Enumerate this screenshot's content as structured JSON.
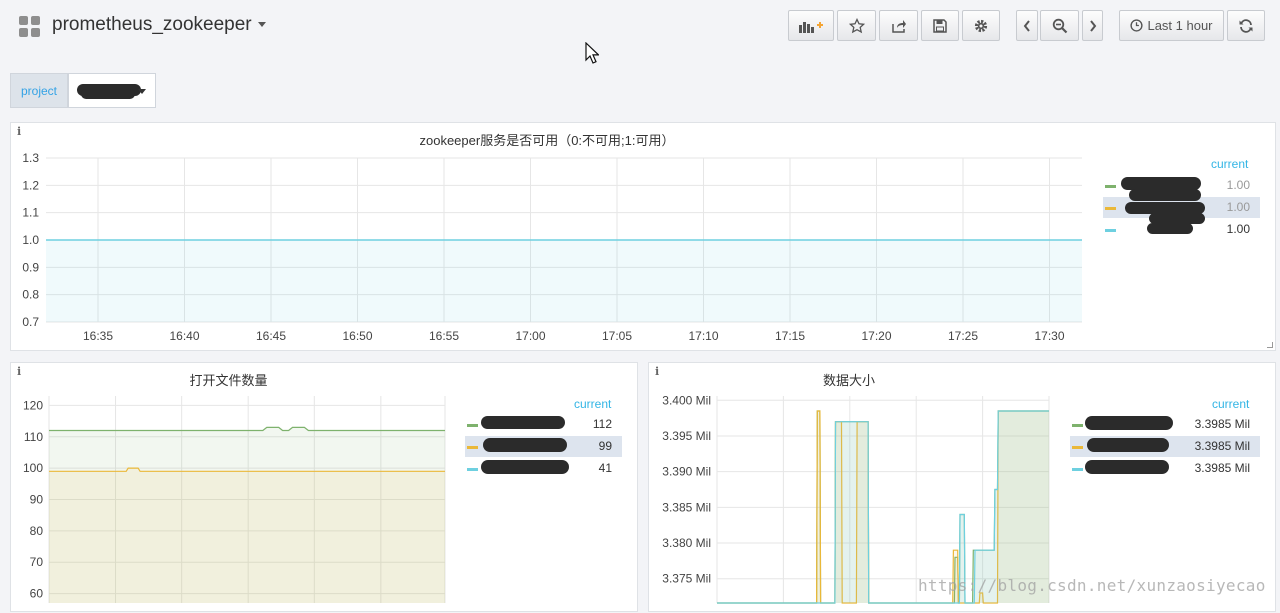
{
  "dashboard": {
    "title": "prometheus_zookeeper"
  },
  "toolbar": {
    "time_range_label": "Last 1 hour"
  },
  "variables": [
    {
      "label": "project"
    }
  ],
  "colors": {
    "green": "#7eb26d",
    "yellow": "#eab839",
    "blue": "#6ed0e0",
    "accent": "#33b5e5"
  },
  "panels": [
    {
      "title": "zookeeper服务是否可用（0:不可用;1:可用）",
      "legend_header": "current",
      "legend": [
        {
          "value": "1.00"
        },
        {
          "value": "1.00"
        },
        {
          "value": "1.00"
        }
      ]
    },
    {
      "title": "打开文件数量",
      "legend_header": "current",
      "legend": [
        {
          "value": "112"
        },
        {
          "value": "99"
        },
        {
          "value": "41"
        }
      ]
    },
    {
      "title": "数据大小",
      "legend_header": "current",
      "legend": [
        {
          "value": "3.3985 Mil"
        },
        {
          "value": "3.3985 Mil"
        },
        {
          "value": "3.3985 Mil"
        }
      ]
    }
  ],
  "chart_data": [
    {
      "type": "line",
      "title": "zookeeper服务是否可用（0:不可用;1:可用）",
      "x": [
        "16:35",
        "16:40",
        "16:45",
        "16:50",
        "16:55",
        "17:00",
        "17:05",
        "17:10",
        "17:15",
        "17:20",
        "17:25",
        "17:30"
      ],
      "y_ticks": [
        "0.7",
        "0.8",
        "0.9",
        "1.0",
        "1.1",
        "1.2",
        "1.3"
      ],
      "ylim": [
        0.7,
        1.3
      ],
      "series": [
        {
          "value": 1.0
        }
      ],
      "grid": true,
      "legend_position": "right"
    },
    {
      "type": "area",
      "title": "打开文件数量",
      "y_ticks": [
        "60",
        "70",
        "80",
        "90",
        "100",
        "110",
        "120"
      ],
      "ylim": [
        57,
        123
      ],
      "series": [
        {
          "color": "green",
          "points": [
            [
              0,
              112
            ],
            [
              0.54,
              112
            ],
            [
              0.55,
              113
            ],
            [
              0.58,
              113
            ],
            [
              0.59,
              112
            ],
            [
              0.605,
              112
            ],
            [
              0.615,
              113
            ],
            [
              0.645,
              113
            ],
            [
              0.655,
              112
            ],
            [
              1,
              112
            ]
          ]
        },
        {
          "color": "yellow",
          "points": [
            [
              0,
              99
            ],
            [
              0.195,
              99
            ],
            [
              0.2,
              100
            ],
            [
              0.225,
              100
            ],
            [
              0.23,
              99
            ],
            [
              1,
              99
            ]
          ]
        }
      ],
      "grid": true,
      "legend_position": "right"
    },
    {
      "type": "area",
      "title": "数据大小",
      "y_ticks": [
        "3.375 Mil",
        "3.380 Mil",
        "3.385 Mil",
        "3.390 Mil",
        "3.395 Mil",
        "3.400 Mil"
      ],
      "ylim": [
        3.3716,
        3.4006
      ],
      "series": [
        {
          "color": "green",
          "points": [
            [
              0,
              3.3716
            ],
            [
              0.3,
              3.3716
            ],
            [
              0.302,
              3.3985
            ],
            [
              0.31,
              3.3985
            ],
            [
              0.312,
              3.3716
            ],
            [
              0.355,
              3.3716
            ],
            [
              0.357,
              3.397
            ],
            [
              0.455,
              3.397
            ],
            [
              0.457,
              3.3716
            ],
            [
              0.715,
              3.3716
            ],
            [
              0.717,
              3.378
            ],
            [
              0.725,
              3.378
            ],
            [
              0.727,
              3.3716
            ],
            [
              0.73,
              3.3716
            ],
            [
              0.732,
              3.384
            ],
            [
              0.745,
              3.384
            ],
            [
              0.747,
              3.3716
            ],
            [
              0.77,
              3.3716
            ],
            [
              0.772,
              3.379
            ],
            [
              0.835,
              3.379
            ],
            [
              0.837,
              3.3875
            ],
            [
              0.845,
              3.3875
            ],
            [
              0.847,
              3.3985
            ],
            [
              1,
              3.3985
            ]
          ]
        },
        {
          "color": "yellow",
          "points": [
            [
              0,
              3.3716
            ],
            [
              0.3,
              3.3716
            ],
            [
              0.302,
              3.3985
            ],
            [
              0.31,
              3.3985
            ],
            [
              0.312,
              3.3716
            ],
            [
              0.355,
              3.3716
            ],
            [
              0.357,
              3.397
            ],
            [
              0.375,
              3.397
            ],
            [
              0.377,
              3.3716
            ],
            [
              0.42,
              3.3716
            ],
            [
              0.422,
              3.397
            ],
            [
              0.455,
              3.397
            ],
            [
              0.457,
              3.3716
            ],
            [
              0.71,
              3.3716
            ],
            [
              0.712,
              3.379
            ],
            [
              0.725,
              3.379
            ],
            [
              0.727,
              3.3716
            ],
            [
              0.79,
              3.3716
            ],
            [
              0.792,
              3.373
            ],
            [
              0.8,
              3.373
            ],
            [
              0.802,
              3.3716
            ],
            [
              0.845,
              3.3716
            ],
            [
              0.847,
              3.3985
            ],
            [
              1,
              3.3985
            ]
          ]
        },
        {
          "color": "blue",
          "points": [
            [
              0,
              3.3716
            ],
            [
              0.355,
              3.3716
            ],
            [
              0.357,
              3.397
            ],
            [
              0.455,
              3.397
            ],
            [
              0.457,
              3.3716
            ],
            [
              0.73,
              3.3716
            ],
            [
              0.732,
              3.384
            ],
            [
              0.745,
              3.384
            ],
            [
              0.747,
              3.3716
            ],
            [
              0.775,
              3.3716
            ],
            [
              0.777,
              3.379
            ],
            [
              0.835,
              3.379
            ],
            [
              0.837,
              3.3875
            ],
            [
              0.845,
              3.3875
            ],
            [
              0.847,
              3.3985
            ],
            [
              1,
              3.3985
            ]
          ]
        }
      ],
      "grid": true,
      "legend_position": "right"
    }
  ],
  "watermark": "https://blog.csdn.net/xunzaosiyecao"
}
